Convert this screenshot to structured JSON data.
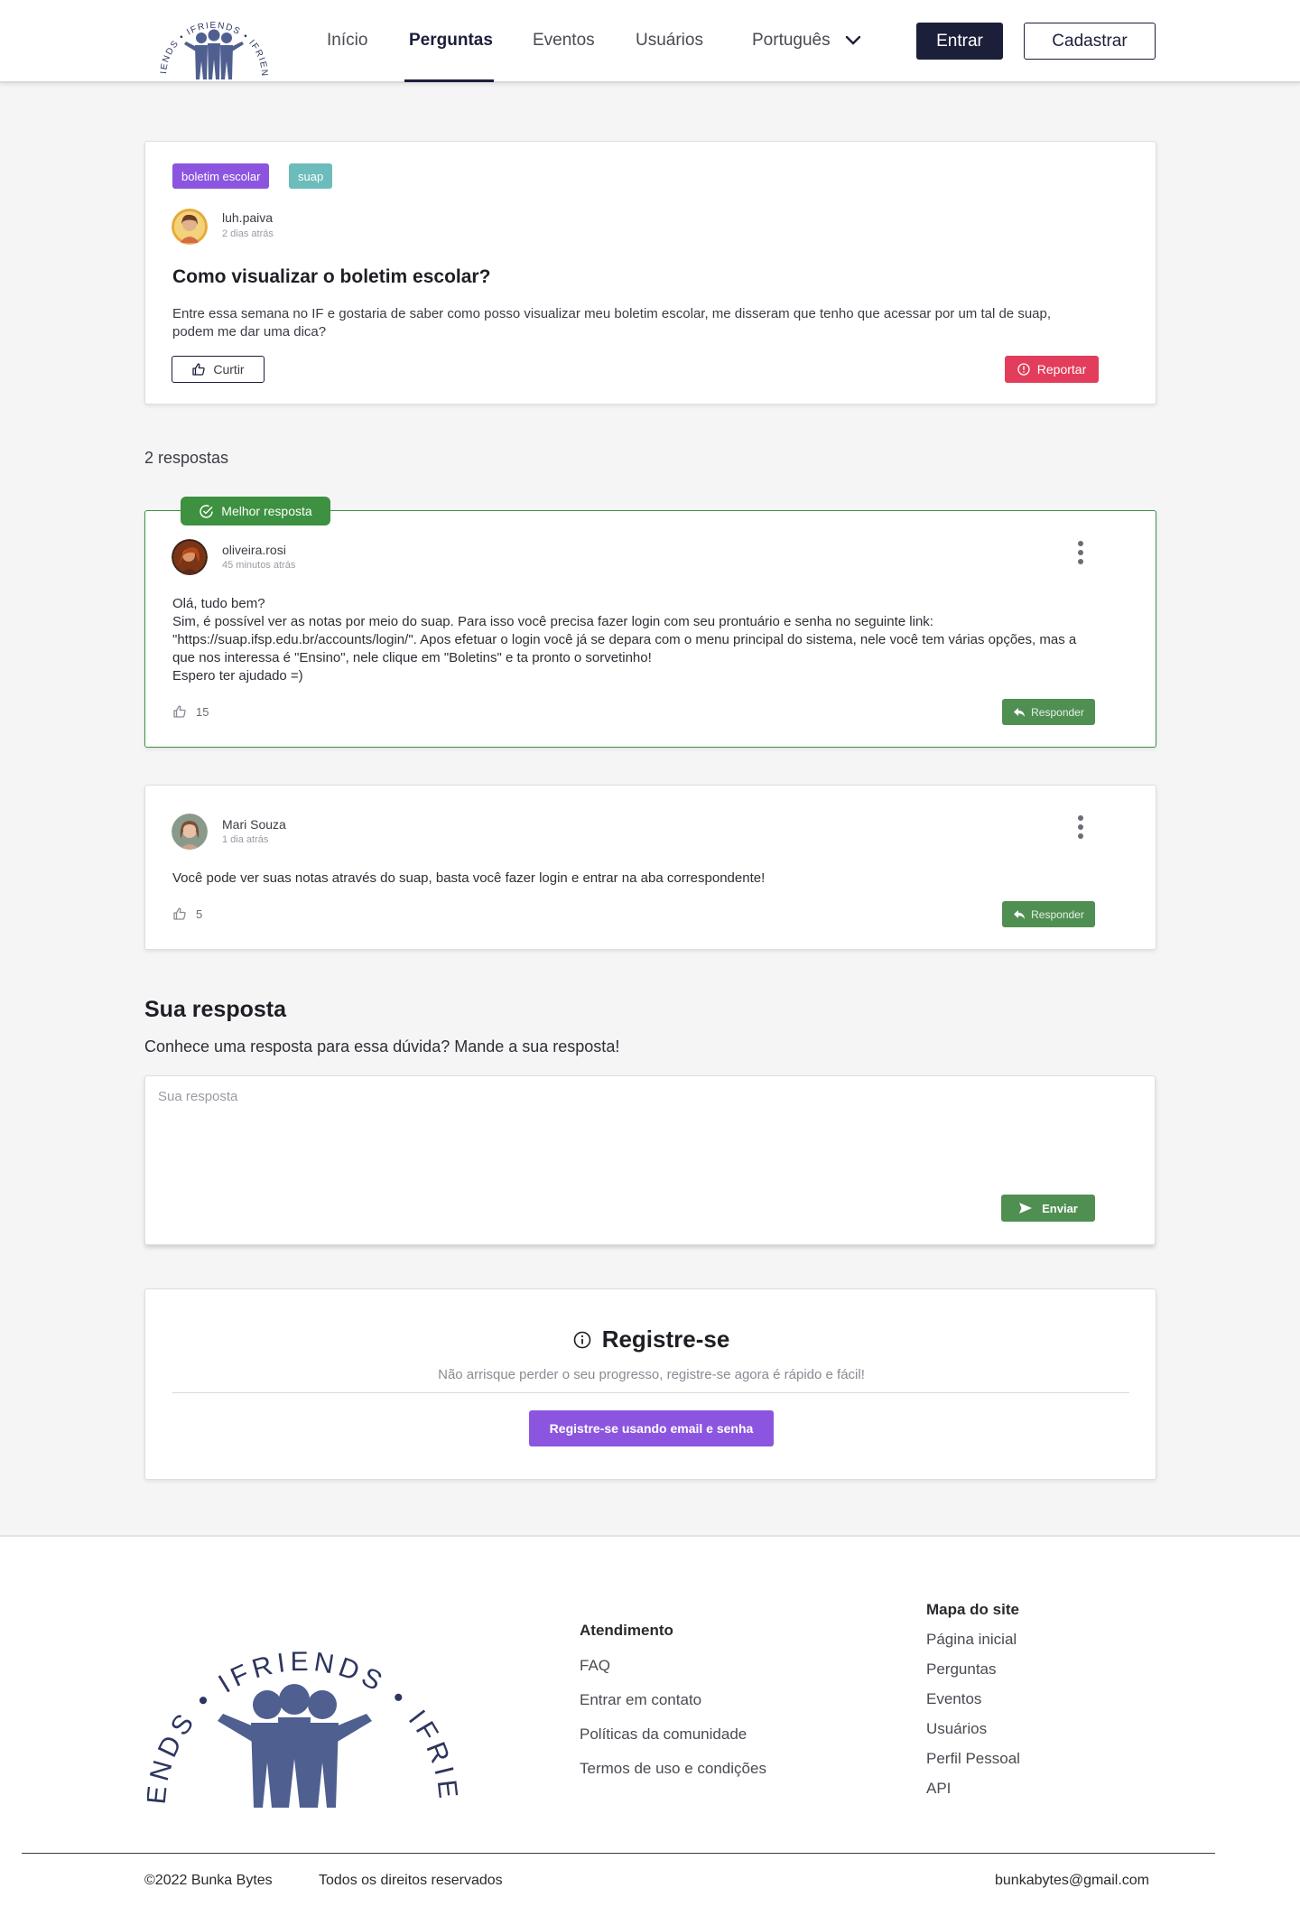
{
  "nav": {
    "logo_text": "IFRIENDS",
    "items": [
      {
        "label": "Início"
      },
      {
        "label": "Perguntas"
      },
      {
        "label": "Eventos"
      },
      {
        "label": "Usuários"
      }
    ],
    "active": "Perguntas",
    "language": "Português",
    "login_label": "Entrar",
    "signup_label": "Cadastrar"
  },
  "question": {
    "tags": [
      "boletim escolar",
      "suap"
    ],
    "author": "luh.paiva",
    "time": "2 dias atrás",
    "title": "Como visualizar o boletim escolar?",
    "body": "Entre essa semana no IF e gostaria de saber como posso visualizar meu boletim escolar, me disseram que tenho que acessar por um tal de suap, podem me dar uma dica?",
    "like_label": "Curtir",
    "report_label": "Reportar"
  },
  "answers_count_label": "2 respostas",
  "answers": [
    {
      "badge": "Melhor resposta",
      "author": "oliveira.rosi",
      "time": "45 minutos atrás",
      "body_lines": [
        "Olá, tudo bem?",
        "Sim, é possível ver as notas por meio do suap. Para isso você precisa fazer login com seu prontuário e senha no seguinte link: \"https://suap.ifsp.edu.br/accounts/login/\". Apos efetuar o login você já se depara com o menu principal do sistema, nele você tem várias opções, mas a que nos interessa é  \"Ensino\", nele clique em \"Boletins\" e ta pronto o sorvetinho!",
        "Espero ter ajudado =)"
      ],
      "likes": "15",
      "reply_label": "Responder"
    },
    {
      "author": "Mari Souza",
      "time": "1 dia atrás",
      "body": "Você pode ver suas notas através do suap, basta você fazer login e entrar na aba correspondente!",
      "likes": "5",
      "reply_label": "Responder"
    }
  ],
  "your_answer": {
    "title": "Sua resposta",
    "subtitle": "Conhece uma resposta para essa dúvida? Mande a sua resposta!",
    "placeholder": "Sua resposta",
    "send_label": "Enviar"
  },
  "register": {
    "title": "Registre-se",
    "subtitle": "Não arrisque perder o seu progresso, registre-se agora é rápido e fácil!",
    "button_label": "Registre-se usando email e senha"
  },
  "footer": {
    "support": {
      "title": "Atendimento",
      "links": [
        "FAQ",
        "Entrar em contato",
        "Políticas da comunidade",
        "Termos de uso e condições"
      ]
    },
    "sitemap": {
      "title": "Mapa do site",
      "links": [
        "Página inicial",
        "Perguntas",
        "Eventos",
        "Usuários",
        "Perfil Pessoal",
        "API"
      ]
    },
    "copyright": "©2022 Bunka Bytes",
    "rights": "Todos os direitos reservados",
    "email": "bunkabytes@gmail.com"
  },
  "colors": {
    "primary_dark": "#1c1f3a",
    "purple": "#8c55e0",
    "teal": "#6dbcbc",
    "green": "#3d9140",
    "red": "#e23d5a",
    "logo_blue": "#4f5f8f"
  }
}
